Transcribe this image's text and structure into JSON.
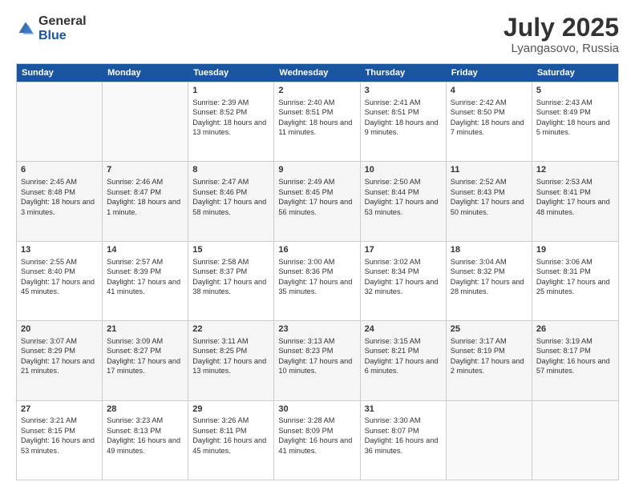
{
  "logo": {
    "general": "General",
    "blue": "Blue"
  },
  "title": "July 2025",
  "location": "Lyangasovo, Russia",
  "days": [
    "Sunday",
    "Monday",
    "Tuesday",
    "Wednesday",
    "Thursday",
    "Friday",
    "Saturday"
  ],
  "weeks": [
    [
      {
        "day": "",
        "sunrise": "",
        "sunset": "",
        "daylight": ""
      },
      {
        "day": "",
        "sunrise": "",
        "sunset": "",
        "daylight": ""
      },
      {
        "day": "1",
        "sunrise": "Sunrise: 2:39 AM",
        "sunset": "Sunset: 8:52 PM",
        "daylight": "Daylight: 18 hours and 13 minutes."
      },
      {
        "day": "2",
        "sunrise": "Sunrise: 2:40 AM",
        "sunset": "Sunset: 8:51 PM",
        "daylight": "Daylight: 18 hours and 11 minutes."
      },
      {
        "day": "3",
        "sunrise": "Sunrise: 2:41 AM",
        "sunset": "Sunset: 8:51 PM",
        "daylight": "Daylight: 18 hours and 9 minutes."
      },
      {
        "day": "4",
        "sunrise": "Sunrise: 2:42 AM",
        "sunset": "Sunset: 8:50 PM",
        "daylight": "Daylight: 18 hours and 7 minutes."
      },
      {
        "day": "5",
        "sunrise": "Sunrise: 2:43 AM",
        "sunset": "Sunset: 8:49 PM",
        "daylight": "Daylight: 18 hours and 5 minutes."
      }
    ],
    [
      {
        "day": "6",
        "sunrise": "Sunrise: 2:45 AM",
        "sunset": "Sunset: 8:48 PM",
        "daylight": "Daylight: 18 hours and 3 minutes."
      },
      {
        "day": "7",
        "sunrise": "Sunrise: 2:46 AM",
        "sunset": "Sunset: 8:47 PM",
        "daylight": "Daylight: 18 hours and 1 minute."
      },
      {
        "day": "8",
        "sunrise": "Sunrise: 2:47 AM",
        "sunset": "Sunset: 8:46 PM",
        "daylight": "Daylight: 17 hours and 58 minutes."
      },
      {
        "day": "9",
        "sunrise": "Sunrise: 2:49 AM",
        "sunset": "Sunset: 8:45 PM",
        "daylight": "Daylight: 17 hours and 56 minutes."
      },
      {
        "day": "10",
        "sunrise": "Sunrise: 2:50 AM",
        "sunset": "Sunset: 8:44 PM",
        "daylight": "Daylight: 17 hours and 53 minutes."
      },
      {
        "day": "11",
        "sunrise": "Sunrise: 2:52 AM",
        "sunset": "Sunset: 8:43 PM",
        "daylight": "Daylight: 17 hours and 50 minutes."
      },
      {
        "day": "12",
        "sunrise": "Sunrise: 2:53 AM",
        "sunset": "Sunset: 8:41 PM",
        "daylight": "Daylight: 17 hours and 48 minutes."
      }
    ],
    [
      {
        "day": "13",
        "sunrise": "Sunrise: 2:55 AM",
        "sunset": "Sunset: 8:40 PM",
        "daylight": "Daylight: 17 hours and 45 minutes."
      },
      {
        "day": "14",
        "sunrise": "Sunrise: 2:57 AM",
        "sunset": "Sunset: 8:39 PM",
        "daylight": "Daylight: 17 hours and 41 minutes."
      },
      {
        "day": "15",
        "sunrise": "Sunrise: 2:58 AM",
        "sunset": "Sunset: 8:37 PM",
        "daylight": "Daylight: 17 hours and 38 minutes."
      },
      {
        "day": "16",
        "sunrise": "Sunrise: 3:00 AM",
        "sunset": "Sunset: 8:36 PM",
        "daylight": "Daylight: 17 hours and 35 minutes."
      },
      {
        "day": "17",
        "sunrise": "Sunrise: 3:02 AM",
        "sunset": "Sunset: 8:34 PM",
        "daylight": "Daylight: 17 hours and 32 minutes."
      },
      {
        "day": "18",
        "sunrise": "Sunrise: 3:04 AM",
        "sunset": "Sunset: 8:32 PM",
        "daylight": "Daylight: 17 hours and 28 minutes."
      },
      {
        "day": "19",
        "sunrise": "Sunrise: 3:06 AM",
        "sunset": "Sunset: 8:31 PM",
        "daylight": "Daylight: 17 hours and 25 minutes."
      }
    ],
    [
      {
        "day": "20",
        "sunrise": "Sunrise: 3:07 AM",
        "sunset": "Sunset: 8:29 PM",
        "daylight": "Daylight: 17 hours and 21 minutes."
      },
      {
        "day": "21",
        "sunrise": "Sunrise: 3:09 AM",
        "sunset": "Sunset: 8:27 PM",
        "daylight": "Daylight: 17 hours and 17 minutes."
      },
      {
        "day": "22",
        "sunrise": "Sunrise: 3:11 AM",
        "sunset": "Sunset: 8:25 PM",
        "daylight": "Daylight: 17 hours and 13 minutes."
      },
      {
        "day": "23",
        "sunrise": "Sunrise: 3:13 AM",
        "sunset": "Sunset: 8:23 PM",
        "daylight": "Daylight: 17 hours and 10 minutes."
      },
      {
        "day": "24",
        "sunrise": "Sunrise: 3:15 AM",
        "sunset": "Sunset: 8:21 PM",
        "daylight": "Daylight: 17 hours and 6 minutes."
      },
      {
        "day": "25",
        "sunrise": "Sunrise: 3:17 AM",
        "sunset": "Sunset: 8:19 PM",
        "daylight": "Daylight: 17 hours and 2 minutes."
      },
      {
        "day": "26",
        "sunrise": "Sunrise: 3:19 AM",
        "sunset": "Sunset: 8:17 PM",
        "daylight": "Daylight: 16 hours and 57 minutes."
      }
    ],
    [
      {
        "day": "27",
        "sunrise": "Sunrise: 3:21 AM",
        "sunset": "Sunset: 8:15 PM",
        "daylight": "Daylight: 16 hours and 53 minutes."
      },
      {
        "day": "28",
        "sunrise": "Sunrise: 3:23 AM",
        "sunset": "Sunset: 8:13 PM",
        "daylight": "Daylight: 16 hours and 49 minutes."
      },
      {
        "day": "29",
        "sunrise": "Sunrise: 3:26 AM",
        "sunset": "Sunset: 8:11 PM",
        "daylight": "Daylight: 16 hours and 45 minutes."
      },
      {
        "day": "30",
        "sunrise": "Sunrise: 3:28 AM",
        "sunset": "Sunset: 8:09 PM",
        "daylight": "Daylight: 16 hours and 41 minutes."
      },
      {
        "day": "31",
        "sunrise": "Sunrise: 3:30 AM",
        "sunset": "Sunset: 8:07 PM",
        "daylight": "Daylight: 16 hours and 36 minutes."
      },
      {
        "day": "",
        "sunrise": "",
        "sunset": "",
        "daylight": ""
      },
      {
        "day": "",
        "sunrise": "",
        "sunset": "",
        "daylight": ""
      }
    ]
  ]
}
